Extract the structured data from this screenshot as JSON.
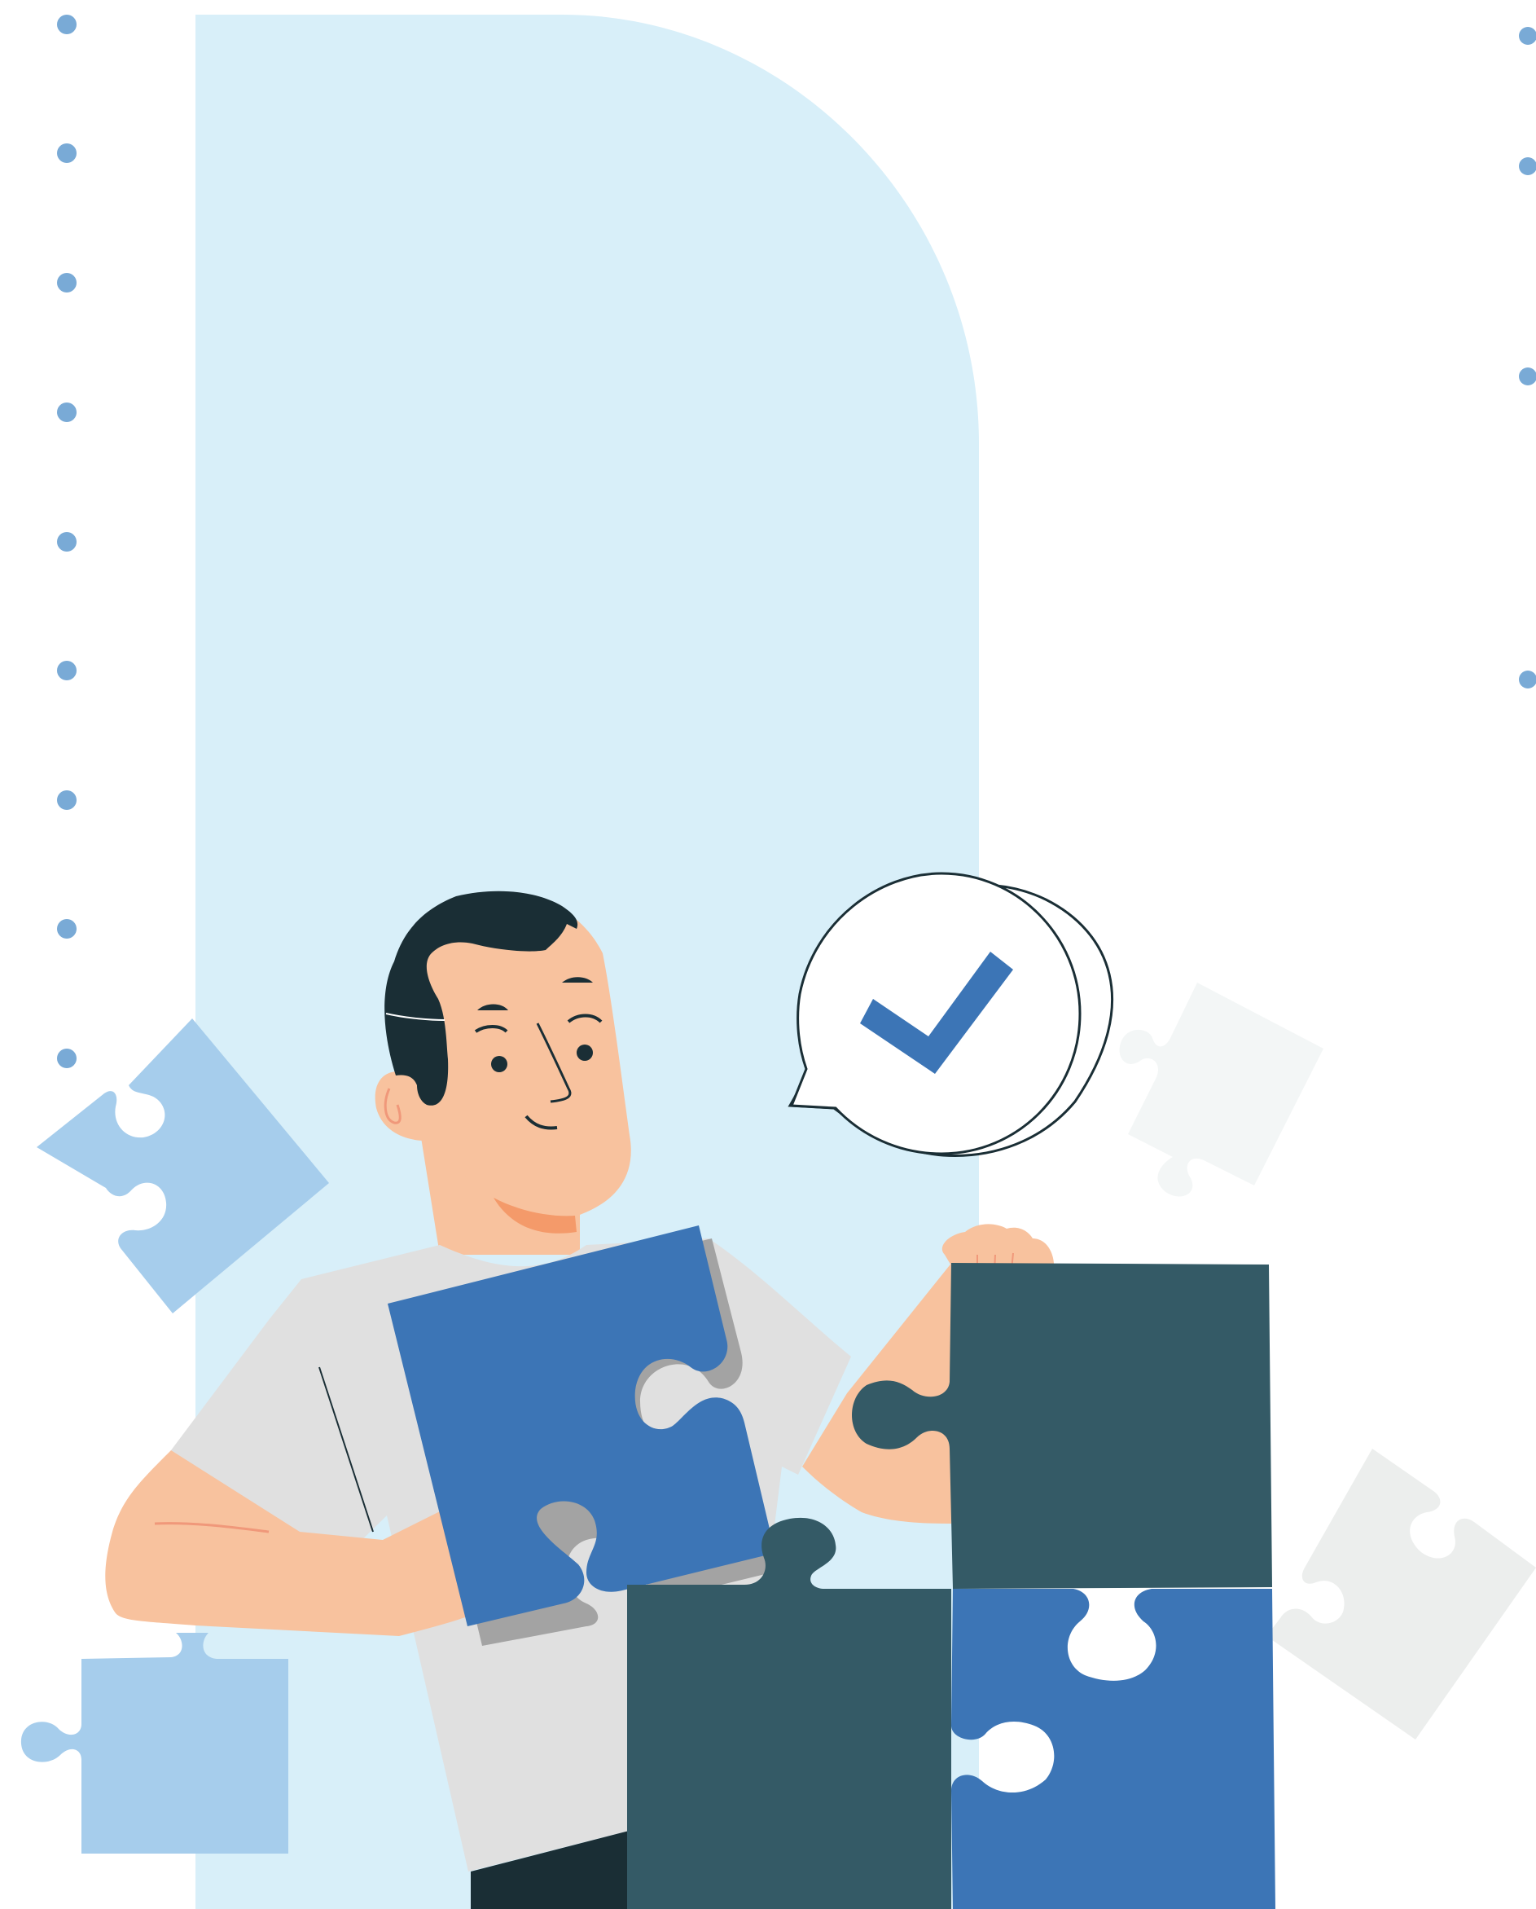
{
  "illustration": {
    "subject": "man-assembling-puzzle",
    "icons": [
      "checkmark-icon",
      "speech-bubble-icon",
      "puzzle-piece-icon"
    ],
    "colors": {
      "background": "#ffffff",
      "backdrop_panel": "#d8eff9",
      "dots": "#79aad6",
      "puzzle_blue": "#3c75b6",
      "puzzle_dark": "#345a66",
      "puzzle_light_blue": "#a6cdec",
      "puzzle_pale_gray": "#eceeed",
      "skin": "#f8c29e",
      "hair": "#1a2e35",
      "shirt": "#e0e0e0",
      "checkmark": "#3c75b6"
    }
  }
}
